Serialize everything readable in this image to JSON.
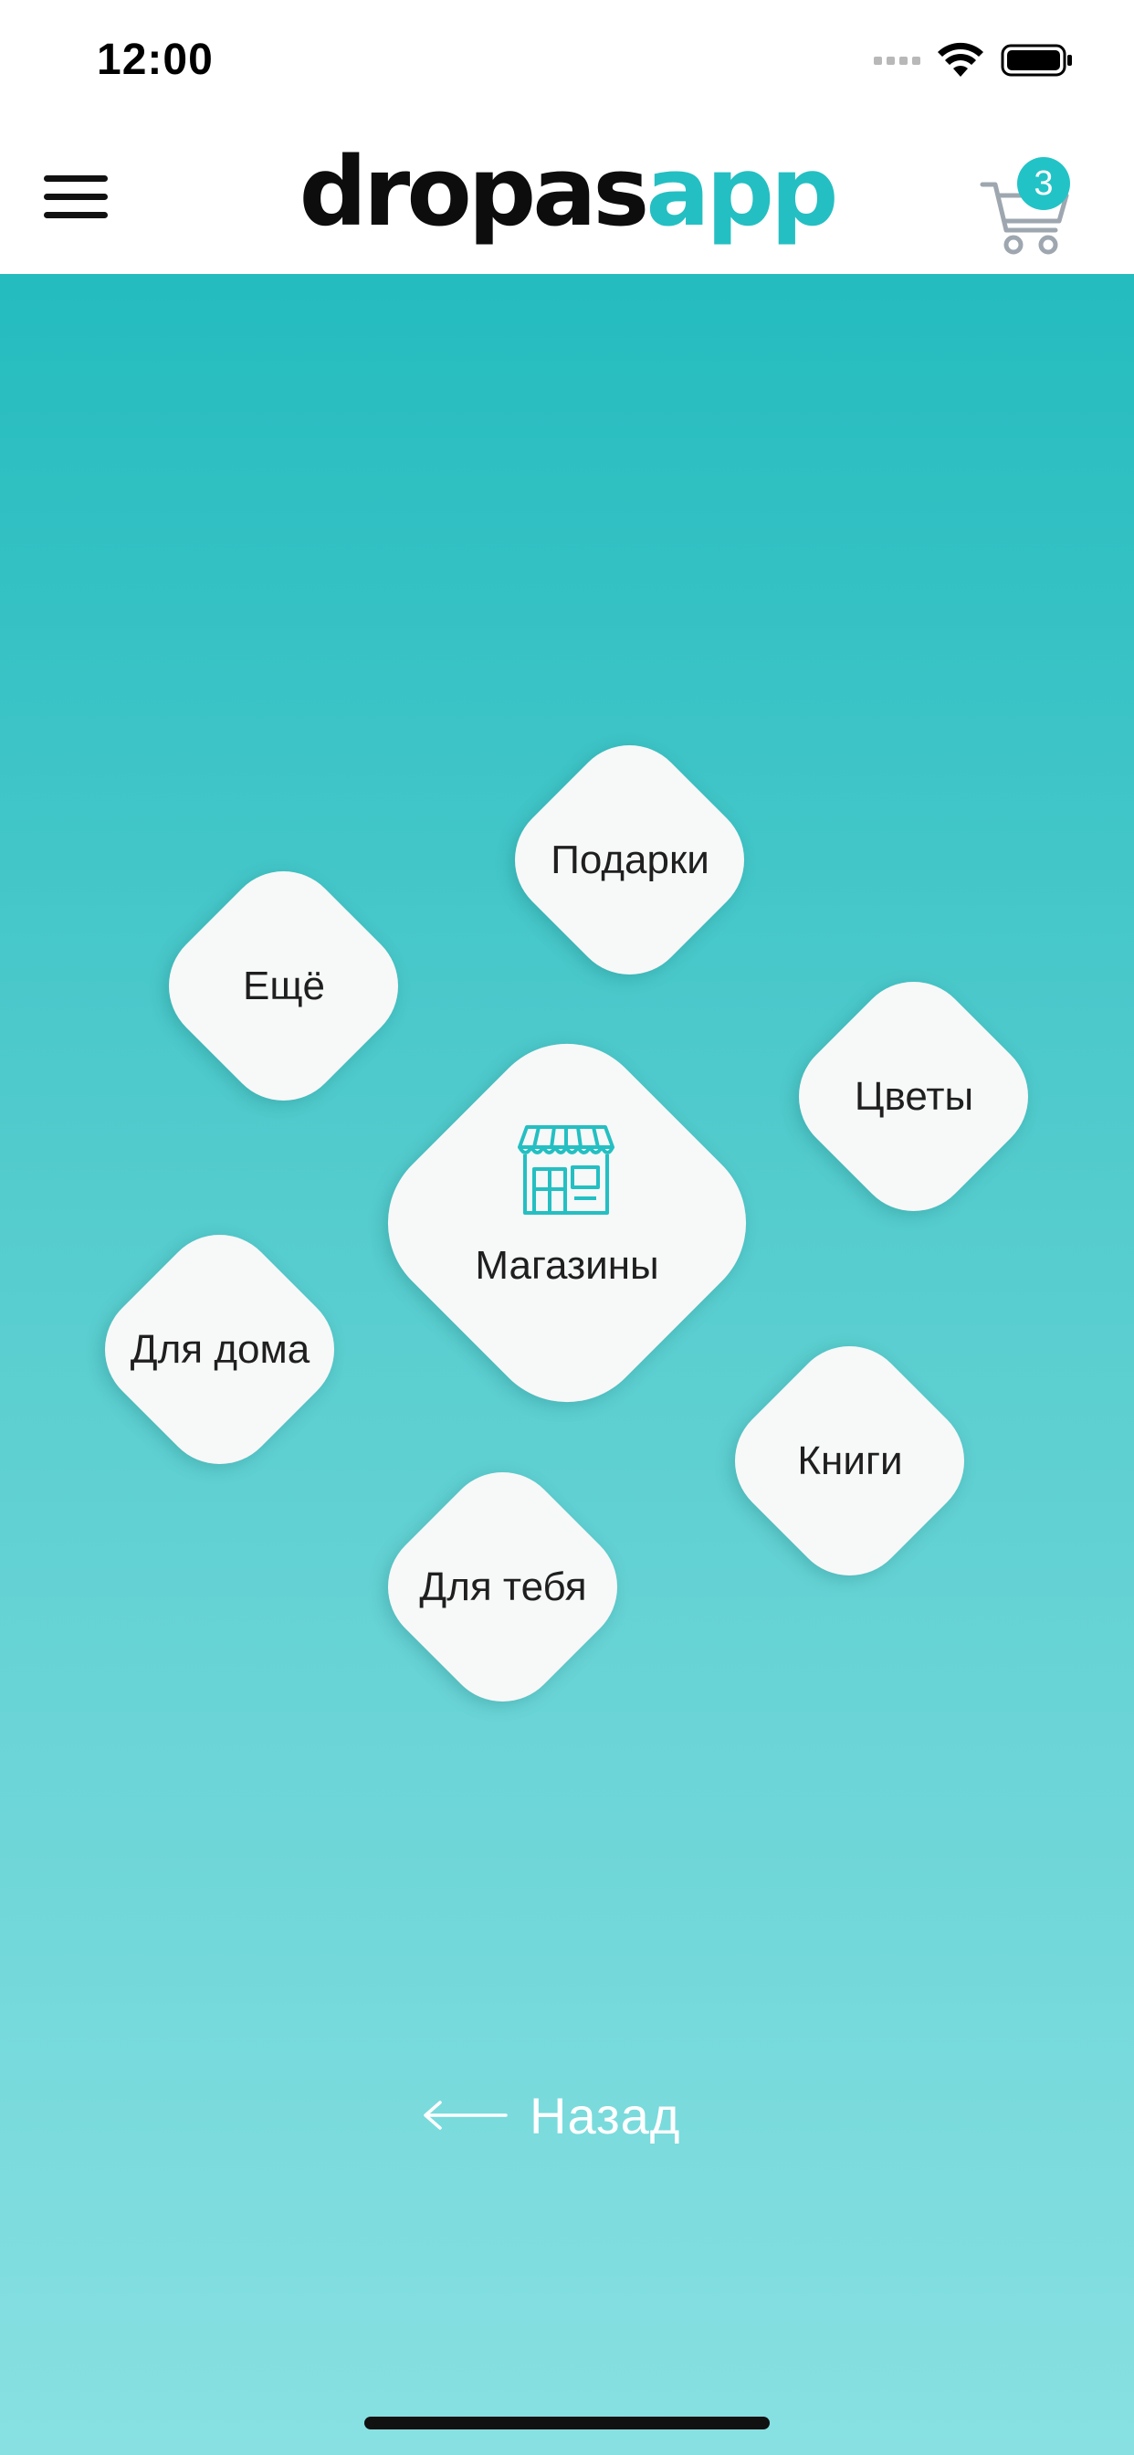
{
  "status_bar": {
    "time": "12:00"
  },
  "header": {
    "logo": {
      "part1": "dropas",
      "part2": "app"
    },
    "cart_count": "3",
    "menu_icon": "hamburger-menu-icon",
    "cart_icon": "shopping-cart-icon"
  },
  "categories": {
    "center": {
      "label": "Магазины",
      "icon": "store-icon"
    },
    "items": [
      {
        "label": "Подарки"
      },
      {
        "label": "Ещё"
      },
      {
        "label": "Цветы"
      },
      {
        "label": "Для дома"
      },
      {
        "label": "Книги"
      },
      {
        "label": "Для тебя"
      }
    ]
  },
  "back": {
    "label": "Назад",
    "icon": "arrow-left-icon"
  },
  "colors": {
    "accent": "#24bfc2",
    "gradient_top": "#24bcbf",
    "gradient_bottom": "#88e0e2",
    "tile": "#f7f8f8"
  }
}
